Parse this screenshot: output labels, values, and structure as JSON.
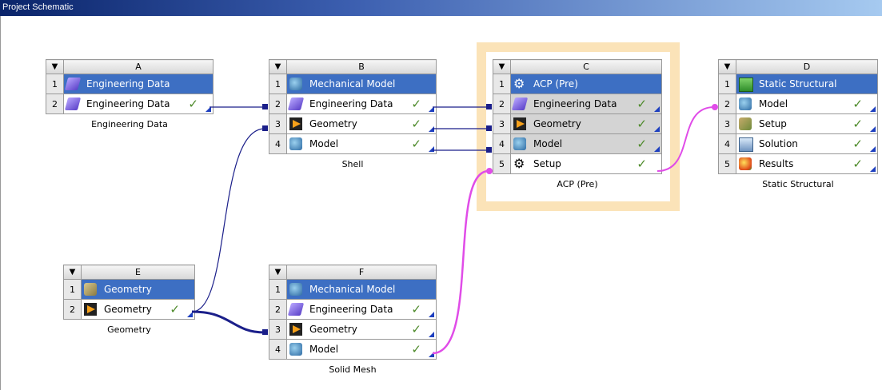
{
  "window": {
    "title": "Project Schematic"
  },
  "systems": {
    "A": {
      "letter": "A",
      "caption": "Engineering Data",
      "rows": [
        {
          "num": "1",
          "label": "Engineering Data",
          "icon": "engineering-data-icon",
          "check": ""
        },
        {
          "num": "2",
          "label": "Engineering Data",
          "icon": "engineering-data-icon",
          "check": "✓"
        }
      ]
    },
    "B": {
      "letter": "B",
      "caption": "Shell",
      "rows": [
        {
          "num": "1",
          "label": "Mechanical Model",
          "icon": "model-icon",
          "check": ""
        },
        {
          "num": "2",
          "label": "Engineering Data",
          "icon": "engineering-data-icon",
          "check": "✓"
        },
        {
          "num": "3",
          "label": "Geometry",
          "icon": "geometry-icon",
          "check": "✓"
        },
        {
          "num": "4",
          "label": "Model",
          "icon": "model-icon",
          "check": "✓"
        }
      ]
    },
    "C": {
      "letter": "C",
      "caption": "ACP (Pre)",
      "rows": [
        {
          "num": "1",
          "label": "ACP (Pre)",
          "icon": "gear-icon",
          "check": ""
        },
        {
          "num": "2",
          "label": "Engineering Data",
          "icon": "engineering-data-icon",
          "check": "✓"
        },
        {
          "num": "3",
          "label": "Geometry",
          "icon": "geometry-icon",
          "check": "✓"
        },
        {
          "num": "4",
          "label": "Model",
          "icon": "model-icon",
          "check": "✓"
        },
        {
          "num": "5",
          "label": "Setup",
          "icon": "gear-icon",
          "check": "✓"
        }
      ]
    },
    "D": {
      "letter": "D",
      "caption": "Static Structural",
      "rows": [
        {
          "num": "1",
          "label": "Static Structural",
          "icon": "static-structural-icon",
          "check": ""
        },
        {
          "num": "2",
          "label": "Model",
          "icon": "model-icon",
          "check": "✓"
        },
        {
          "num": "3",
          "label": "Setup",
          "icon": "setup-icon",
          "check": "✓"
        },
        {
          "num": "4",
          "label": "Solution",
          "icon": "solution-icon",
          "check": "✓"
        },
        {
          "num": "5",
          "label": "Results",
          "icon": "results-icon",
          "check": "✓"
        }
      ]
    },
    "E": {
      "letter": "E",
      "caption": "Geometry",
      "rows": [
        {
          "num": "1",
          "label": "Geometry",
          "icon": "geometry-cube-icon",
          "check": ""
        },
        {
          "num": "2",
          "label": "Geometry",
          "icon": "geometry-icon",
          "check": "✓"
        }
      ]
    },
    "F": {
      "letter": "F",
      "caption": "Solid Mesh",
      "rows": [
        {
          "num": "1",
          "label": "Mechanical Model",
          "icon": "model-icon",
          "check": ""
        },
        {
          "num": "2",
          "label": "Engineering Data",
          "icon": "engineering-data-icon",
          "check": "✓"
        },
        {
          "num": "3",
          "label": "Geometry",
          "icon": "geometry-icon",
          "check": "✓"
        },
        {
          "num": "4",
          "label": "Model",
          "icon": "model-icon",
          "check": "✓"
        }
      ]
    }
  },
  "colors": {
    "share_link": "#1b1f8a",
    "transfer_link": "#e04ce8",
    "selection": "#3d6fc3",
    "highlight": "#fbe3b8"
  }
}
